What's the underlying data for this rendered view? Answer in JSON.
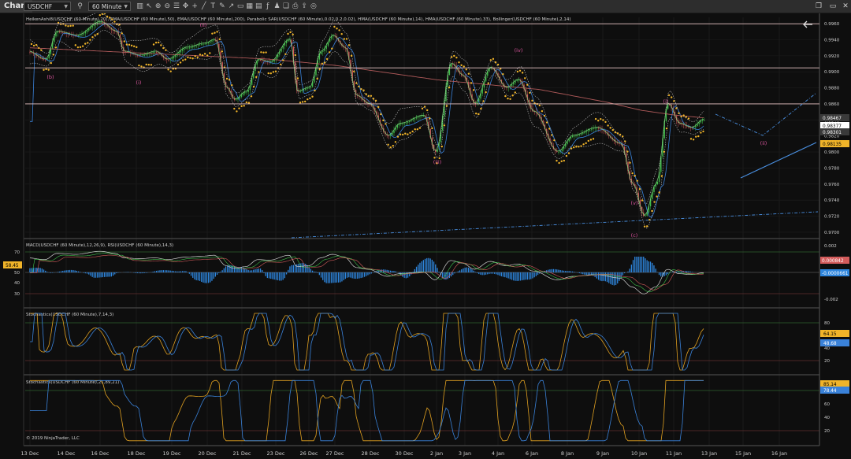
{
  "app": {
    "title": "Chart",
    "instrument": "USDCHF",
    "interval": "60 Minute"
  },
  "toolbar_icons": [
    "search-icon",
    "bar-type-icon",
    "pointer-icon",
    "zoom-in-icon",
    "zoom-out-icon",
    "properties-icon",
    "pan-icon",
    "crosshair-icon",
    "line-tool-icon",
    "text-tool-icon",
    "draw-icon",
    "arrow-tool-icon",
    "rectangle-icon",
    "grid-icon",
    "data-box-icon",
    "indicators-icon",
    "strategies-icon",
    "templates-icon",
    "print-icon",
    "share-icon",
    "camera-icon"
  ],
  "panels": {
    "price": {
      "legend": "HeikenAshi8(USDCHF (60 Minute),20), EMA(USDCHF (60 Minute),50), EMA(USDCHF (60 Minute),200), Parabolic SAR(USDCHF (60 Minute),0.02,0.2,0.02), HMA(USDCHF (60 Minute),14), HMA(USDCHF (60 Minute),33), Bollinger(USDCHF (60 Minute),2,14)",
      "ticks": [
        "0.9960",
        "0.9940",
        "0.9920",
        "0.9900",
        "0.9880",
        "0.9860",
        "0.9840",
        "0.9820",
        "0.9800",
        "0.9780",
        "0.9760",
        "0.9740",
        "0.9720",
        "0.9700"
      ],
      "tags": [
        "0.98467",
        "0.98377",
        "0.98301",
        "0.98135"
      ],
      "tag_colors": [
        "#3a3a3a",
        "#ffffff",
        "#3a3a3a",
        "#f0b429"
      ],
      "wave_labels": [
        "(b)",
        "(i)",
        "(ii)",
        "(iii)",
        "(iv)",
        "(v)",
        "(c)",
        "(i)",
        "(ii)"
      ],
      "levels": [
        0.996,
        0.9905,
        0.986
      ]
    },
    "macd": {
      "legend": "MACD(USDCHF (60 Minute),12,26,9), RSI(USDCHF (60 Minute),14,3)",
      "left_ticks": [
        "70",
        "50",
        "40",
        "30"
      ],
      "right_ticks": [
        "0.002",
        "0",
        "-0.002"
      ],
      "rsi_tag": "58.45",
      "tags": [
        "0.000842",
        "-0.0000661"
      ]
    },
    "stoch1": {
      "legend": "Stochastics(USDCHF (60 Minute),7,14,3)",
      "ticks": [
        "80",
        "60",
        "40",
        "20"
      ],
      "tags": [
        "64.15",
        "48.68"
      ]
    },
    "stoch2": {
      "legend": "Stochastics(USDCHF (60 Minute),21,89,21)",
      "ticks": [
        "80",
        "60",
        "40",
        "20"
      ],
      "tags": [
        "85.14",
        "78.44"
      ],
      "copyright": "© 2019 NinjaTrader, LLC"
    }
  },
  "x_axis": [
    "13 Dec",
    "14 Dec",
    "16 Dec",
    "18 Dec",
    "19 Dec",
    "20 Dec",
    "21 Dec",
    "23 Dec",
    "26 Dec",
    "27 Dec",
    "28 Dec",
    "30 Dec",
    "2 Jan",
    "3 Jan",
    "4 Jan",
    "6 Jan",
    "8 Jan",
    "9 Jan",
    "10 Jan",
    "11 Jan",
    "13 Jan",
    "15 Jan",
    "16 Jan"
  ],
  "chart_data": {
    "type": "line",
    "symbol": "USDCHF",
    "interval": "60 Minute",
    "x": [
      "13 Dec",
      "14 Dec",
      "16 Dec",
      "18 Dec",
      "19 Dec",
      "20 Dec",
      "21 Dec",
      "23 Dec",
      "26 Dec",
      "27 Dec",
      "28 Dec",
      "30 Dec",
      "2 Jan",
      "3 Jan",
      "4 Jan",
      "6 Jan",
      "8 Jan",
      "9 Jan",
      "10 Jan",
      "11 Jan",
      "13 Jan"
    ],
    "series": [
      {
        "name": "HeikenAshi8",
        "values": [
          0.9925,
          0.9935,
          0.9955,
          0.992,
          0.9915,
          0.9925,
          0.986,
          0.9915,
          0.988,
          0.993,
          0.986,
          0.9825,
          0.984,
          0.9905,
          0.988,
          0.9885,
          0.981,
          0.9825,
          0.972,
          0.984,
          0.9838
        ]
      },
      {
        "name": "EMA 200",
        "values": [
          0.993,
          0.9928,
          0.9926,
          0.9924,
          0.9922,
          0.992,
          0.9918,
          0.9916,
          0.9912,
          0.9908,
          0.9902,
          0.9896,
          0.989,
          0.9886,
          0.9882,
          0.9878,
          0.987,
          0.9862,
          0.9852,
          0.9846,
          0.9842
        ]
      }
    ],
    "ylim": [
      0.9695,
      0.9968
    ]
  }
}
